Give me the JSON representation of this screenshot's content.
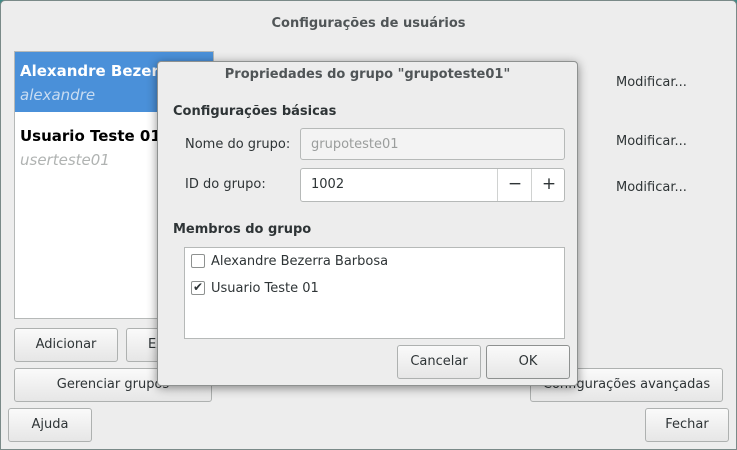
{
  "window": {
    "title": "Configurações de usuários"
  },
  "users": [
    {
      "name": "Alexandre Bezerra",
      "login": "alexandre",
      "selected": true
    },
    {
      "name": "Usuario Teste 01",
      "login": "userteste01",
      "selected": false
    }
  ],
  "main": {
    "modify_labels": [
      "Modificar...",
      "Modificar...",
      "Modificar..."
    ],
    "add_label": "Adicionar",
    "remove_label": "Ex",
    "manage_groups_label": "Gerenciar grupos",
    "advanced_label": "Configurações avançadas",
    "help_label": "Ajuda",
    "close_label": "Fechar"
  },
  "dialog": {
    "title": "Propriedades do grupo \"grupoteste01\"",
    "basic_section": "Configurações básicas",
    "group_name_label": "Nome do grupo:",
    "group_name_value": "grupoteste01",
    "group_id_label": "ID do grupo:",
    "group_id_value": "1002",
    "decrement_symbol": "−",
    "increment_symbol": "+",
    "members_section": "Membros do grupo",
    "members": [
      {
        "name": "Alexandre Bezerra Barbosa",
        "checked": false
      },
      {
        "name": "Usuario Teste 01",
        "checked": true
      }
    ],
    "cancel_label": "Cancelar",
    "ok_label": "OK",
    "checkmark": "✔"
  },
  "colors": {
    "desktop": "#3d8a86",
    "selection": "#4a90d9"
  }
}
